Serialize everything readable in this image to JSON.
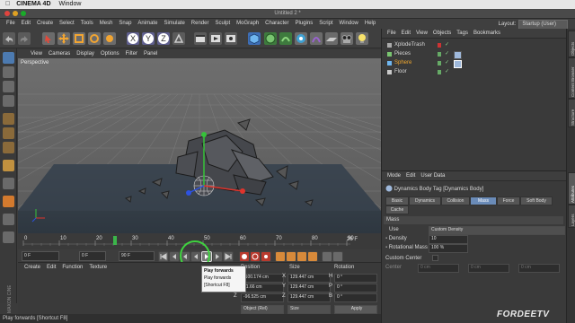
{
  "mac_menubar": {
    "apple": "",
    "app": "CINEMA 4D",
    "window": "Window"
  },
  "title": "Untitled 2 *",
  "menus": [
    "File",
    "Edit",
    "Create",
    "Select",
    "Tools",
    "Mesh",
    "Snap",
    "Animate",
    "Simulate",
    "Render",
    "Sculpt",
    "MoGraph",
    "Character",
    "Plugins",
    "Script",
    "Window",
    "Help"
  ],
  "layout": {
    "label": "Layout:",
    "value": "Startup (User)"
  },
  "viewport": {
    "menus": [
      "View",
      "Cameras",
      "Display",
      "Options",
      "Filter",
      "Panel"
    ],
    "label": "Perspective"
  },
  "timeline": {
    "ticks": [
      "0",
      "10",
      "20",
      "30",
      "40",
      "50",
      "60",
      "70",
      "80",
      "90"
    ],
    "end_label": "26 F"
  },
  "transport": {
    "current_frame": "0 F",
    "start_frame": "0 F",
    "end_frame": "90 F"
  },
  "tooltip": {
    "title": "Play forwards",
    "line1": "Play forwards",
    "line2": "[Shortcut F8]"
  },
  "material_menu": [
    "Create",
    "Edit",
    "Function",
    "Texture"
  ],
  "coords": {
    "headers": [
      "Position",
      "Size",
      "Rotation"
    ],
    "rows": [
      {
        "axis": "X",
        "pos": "-100.174 cm",
        "saxis": "X",
        "size": "129.447 cm",
        "raxis": "H",
        "rot": "0 °"
      },
      {
        "axis": "Y",
        "pos": "81.66 cm",
        "saxis": "Y",
        "size": "129.447 cm",
        "raxis": "P",
        "rot": "0 °"
      },
      {
        "axis": "Z",
        "pos": "-96.525 cm",
        "saxis": "Z",
        "size": "129.447 cm",
        "raxis": "B",
        "rot": "0 °"
      }
    ],
    "mode1": "Object (Rel)",
    "mode2": "Size",
    "apply": "Apply"
  },
  "status": "Play forwards [Shortcut F8]",
  "object_manager": {
    "menus": [
      "File",
      "Edit",
      "View",
      "Objects",
      "Tags",
      "Bookmarks"
    ],
    "objects": [
      {
        "name": "XplodeTrash",
        "selected": false
      },
      {
        "name": "Pieces",
        "selected": false
      },
      {
        "name": "Sphere",
        "selected": true
      },
      {
        "name": "Floor",
        "selected": false
      }
    ]
  },
  "attributes": {
    "menus": [
      "Mode",
      "Edit",
      "User Data"
    ],
    "tag_title": "Dynamics Body Tag [Dynamics Body]",
    "tabs": [
      "Basic",
      "Dynamics",
      "Collision",
      "Mass",
      "Force",
      "Soft Body",
      "Cache"
    ],
    "active_tab": "Mass",
    "section": "Mass",
    "use_label": "Use",
    "use_value": "Custom Density",
    "density_label": "Density",
    "density_value": "10",
    "rot_mass_label": "Rotational Mass",
    "rot_mass_value": "100 %",
    "custom_center_label": "Custom Center",
    "center_label": "Center",
    "center_x": "0 cm",
    "center_y": "0 cm",
    "center_z": "0 cm"
  },
  "right_tabs": [
    "Objects",
    "Content Browser",
    "Structure",
    "Attributes",
    "Layers"
  ],
  "watermark": "FORDEETV",
  "maxon": "MAXON CINEMA 4D"
}
